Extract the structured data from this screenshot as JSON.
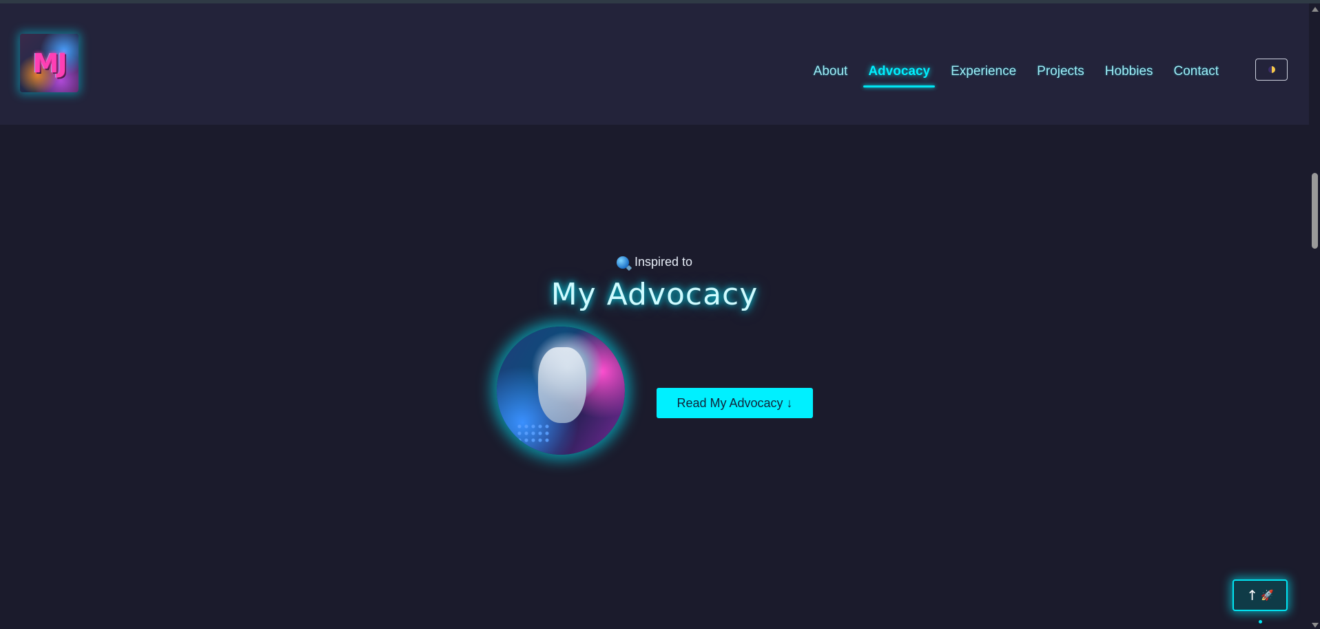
{
  "logo": {
    "text": "MJ"
  },
  "nav": {
    "items": [
      {
        "label": "About"
      },
      {
        "label": "Advocacy"
      },
      {
        "label": "Experience"
      },
      {
        "label": "Projects"
      },
      {
        "label": "Hobbies"
      },
      {
        "label": "Contact"
      }
    ],
    "active": "Advocacy"
  },
  "theme_toggle": {
    "icon": "half-moon-icon"
  },
  "hero": {
    "subtitle": "Inspired to",
    "subtitle_icon": "pin-icon",
    "title": "My Advocacy",
    "avatar_icon": "robot-portrait",
    "button_label": "Read My Advocacy ↓"
  },
  "back_to_top": {
    "arrow": "↑",
    "icon": "rocket-icon"
  },
  "colors": {
    "accent": "#00f0ff",
    "background": "#1b1b2c",
    "header": "#23233a",
    "nav_text": "#9eeef6"
  }
}
